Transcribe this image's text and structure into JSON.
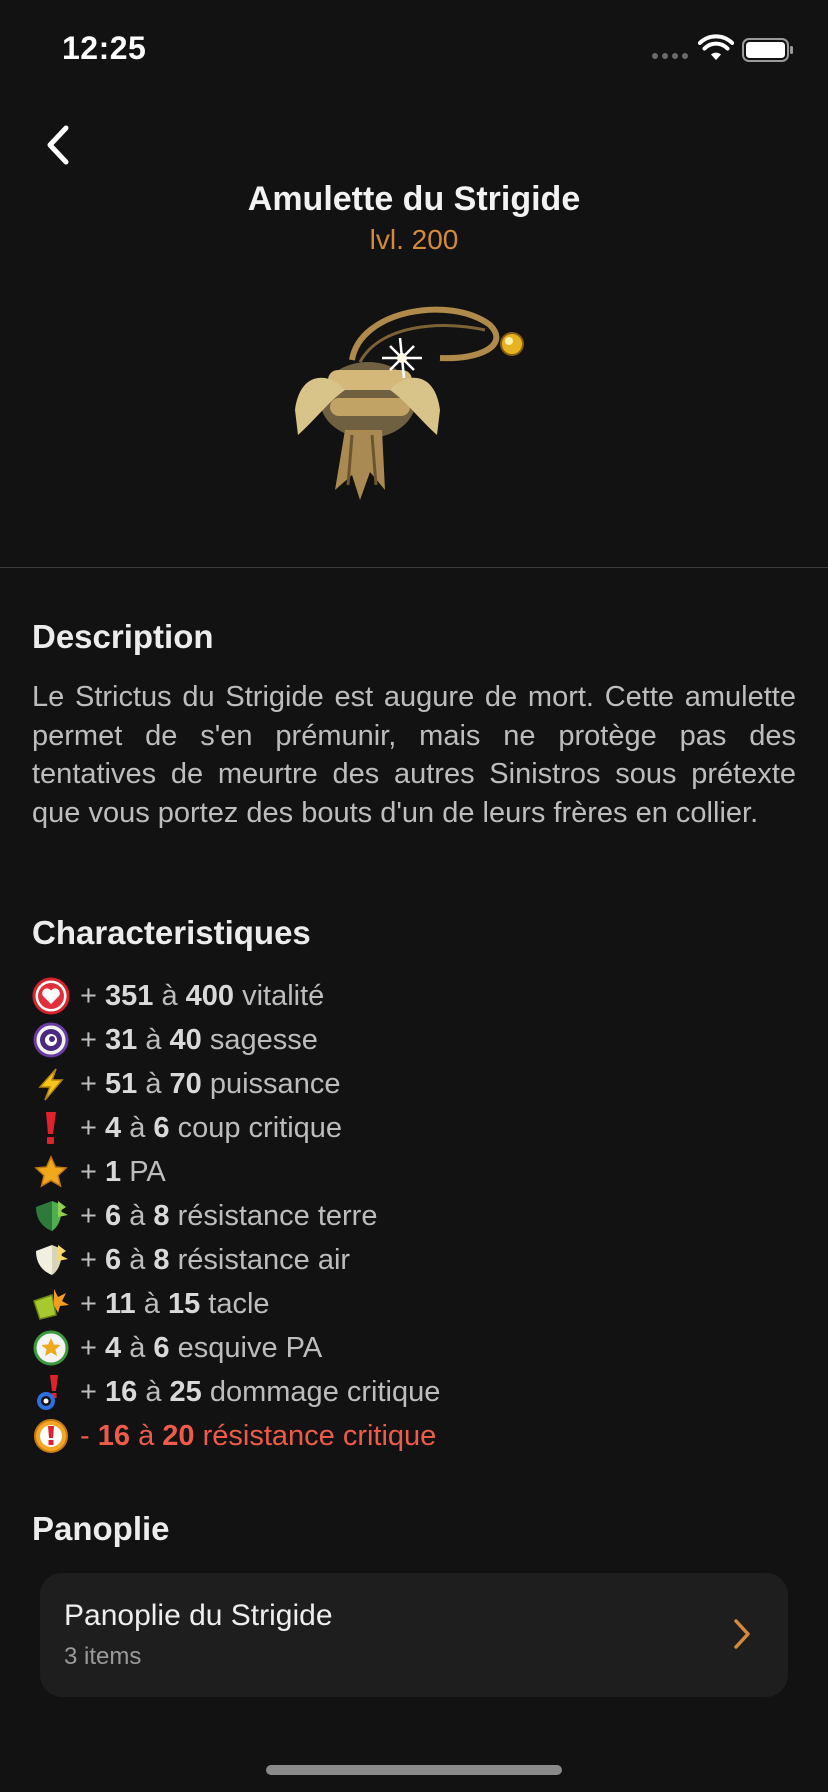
{
  "status_bar": {
    "time": "12:25"
  },
  "header": {
    "back_icon": "chevron-left-icon"
  },
  "item": {
    "title": "Amulette du Strigide",
    "level": "lvl. 200",
    "image_icon": "amulet-image"
  },
  "description": {
    "heading": "Description",
    "text": "Le Strictus du Strigide est augure de mort. Cette amulette permet de s'en prémunir, mais ne protège pas des tentatives de meurtre des autres Sinistros sous prétexte que vous portez des bouts d'un de leurs frères en collier."
  },
  "characteristics": {
    "heading": "Characteristiques",
    "stats": [
      {
        "icon": "heart-icon",
        "sign": "+",
        "min": "351",
        "sep": "à",
        "max": "400",
        "label": "vitalité",
        "negative": false
      },
      {
        "icon": "wisdom-icon",
        "sign": "+",
        "min": "31",
        "sep": "à",
        "max": "40",
        "label": "sagesse",
        "negative": false
      },
      {
        "icon": "lightning-icon",
        "sign": "+",
        "min": "51",
        "sep": "à",
        "max": "70",
        "label": "puissance",
        "negative": false
      },
      {
        "icon": "exclamation-icon",
        "sign": "+",
        "min": "4",
        "sep": "à",
        "max": "6",
        "label": "coup critique",
        "negative": false
      },
      {
        "icon": "star-icon",
        "sign": "+",
        "min": "1",
        "sep": "",
        "max": "",
        "label": "PA",
        "negative": false
      },
      {
        "icon": "earth-shield-icon",
        "sign": "+",
        "min": "6",
        "sep": "à",
        "max": "8",
        "label": "résistance terre",
        "negative": false
      },
      {
        "icon": "air-shield-icon",
        "sign": "+",
        "min": "6",
        "sep": "à",
        "max": "8",
        "label": "résistance air",
        "negative": false
      },
      {
        "icon": "tackle-icon",
        "sign": "+",
        "min": "11",
        "sep": "à",
        "max": "15",
        "label": "tacle",
        "negative": false
      },
      {
        "icon": "dodge-ap-icon",
        "sign": "+",
        "min": "4",
        "sep": "à",
        "max": "6",
        "label": "esquive PA",
        "negative": false
      },
      {
        "icon": "critical-damage-icon",
        "sign": "+",
        "min": "16",
        "sep": "à",
        "max": "25",
        "label": "dommage critique",
        "negative": false
      },
      {
        "icon": "critical-resist-icon",
        "sign": "-",
        "min": "16",
        "sep": "à",
        "max": "20",
        "label": "résistance critique",
        "negative": true
      }
    ]
  },
  "panoplie": {
    "heading": "Panoplie",
    "set_name": "Panoplie du Strigide",
    "set_count": "3 items",
    "chevron_icon": "chevron-right-icon"
  },
  "colors": {
    "background": "#121212",
    "accent": "#d58a3a",
    "negative": "#ee5b4a",
    "card": "#1e1e1e"
  }
}
